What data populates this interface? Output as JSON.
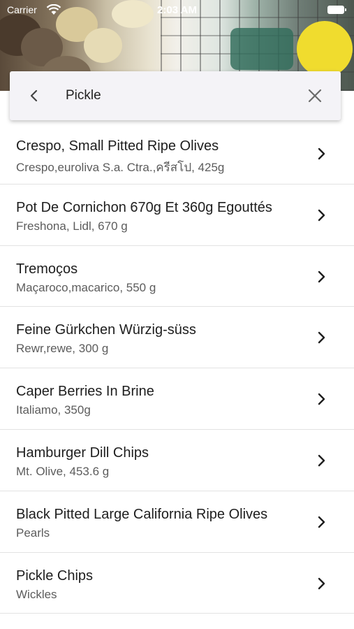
{
  "status_bar": {
    "carrier": "Carrier",
    "time": "2:03 AM"
  },
  "search": {
    "value": "Pickle",
    "back_icon": "chevron-left-icon",
    "clear_icon": "close-icon"
  },
  "results": [
    {
      "title": "Crespo, Small Pitted Ripe Olives",
      "subtitle": "Crespo,euroliva  S.a.  Ctra.,ครีสโป, 425g"
    },
    {
      "title": "Pot De Cornichon 670g Et 360g Egouttés",
      "subtitle": "Freshona, Lidl, 670 g"
    },
    {
      "title": "Tremoços",
      "subtitle": "Maçaroco,macarico, 550 g"
    },
    {
      "title": "Feine Gürkchen Würzig-süss",
      "subtitle": "Rewr,rewe, 300 g"
    },
    {
      "title": "Caper Berries In Brine",
      "subtitle": "Italiamo, 350g"
    },
    {
      "title": "Hamburger Dill Chips",
      "subtitle": "Mt. Olive, 453.6 g"
    },
    {
      "title": "Black Pitted Large California Ripe Olives",
      "subtitle": "Pearls"
    },
    {
      "title": "Pickle Chips",
      "subtitle": "Wickles"
    }
  ],
  "colors": {
    "text_primary": "#1e1e1e",
    "text_secondary": "#5c5c5c",
    "divider": "#e3e3e3",
    "search_bg": "#f4f3f7"
  }
}
